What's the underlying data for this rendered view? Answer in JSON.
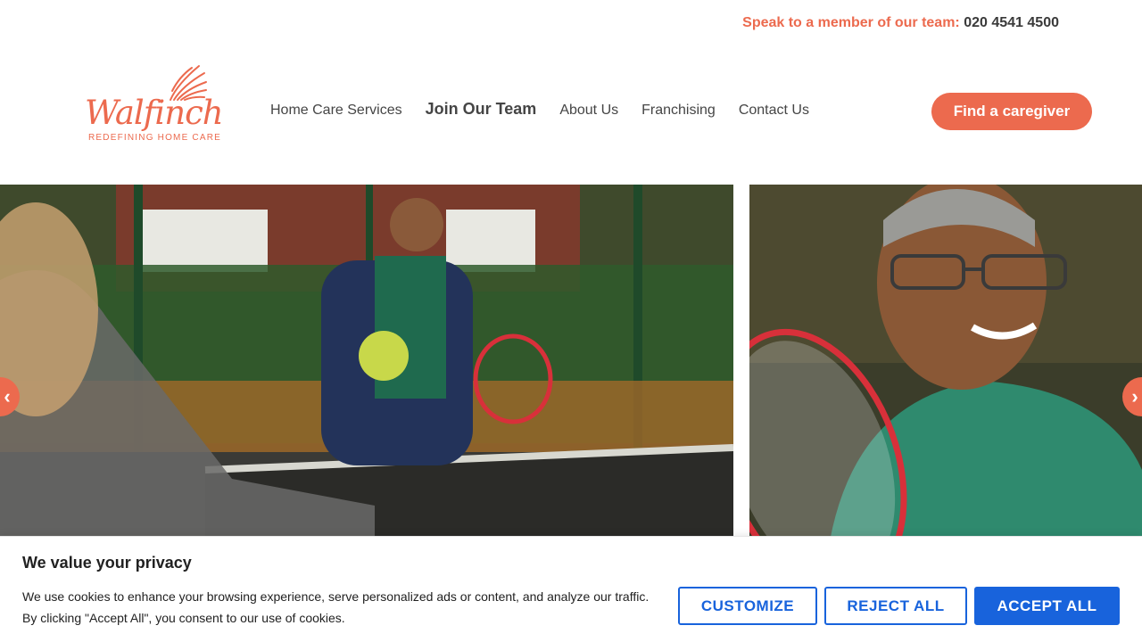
{
  "topbar": {
    "prompt": "Speak to a member of our team:",
    "phone": "020 4541 4500"
  },
  "logo": {
    "wordmark": "Walfinch",
    "tagline": "REDEFINING HOME CARE"
  },
  "nav": {
    "items": [
      {
        "label": "Home Care Services"
      },
      {
        "label": "Join Our Team"
      },
      {
        "label": "About Us"
      },
      {
        "label": "Franchising"
      },
      {
        "label": "Contact Us"
      }
    ]
  },
  "cta": {
    "label": "Find a caregiver"
  },
  "slider": {
    "prev_glyph": "‹",
    "next_glyph": "›"
  },
  "cookie": {
    "title": "We value your privacy",
    "text_line1": "We use cookies to enhance your browsing experience, serve personalized ads or content, and analyze our traffic.",
    "text_line2": "By clicking \"Accept All\", you consent to our use of cookies.",
    "customize": "CUSTOMIZE",
    "reject": "REJECT ALL",
    "accept": "ACCEPT ALL"
  },
  "colors": {
    "brand": "#ec6a4e",
    "cookie_blue": "#1863dc",
    "text": "#3a3a3a"
  },
  "icons": [
    "wing-icon",
    "chevron-left-icon",
    "chevron-right-icon"
  ]
}
